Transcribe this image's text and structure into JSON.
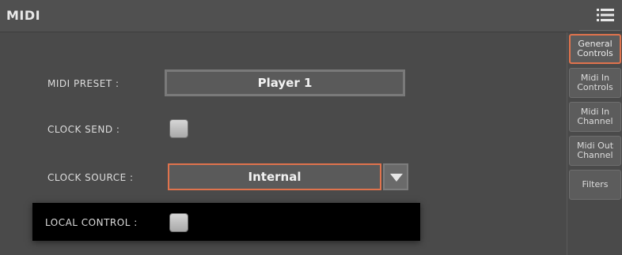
{
  "window": {
    "title": "MIDI"
  },
  "header": {
    "menu_icon": "hamburger-menu-icon"
  },
  "form": {
    "midi_preset": {
      "label": "MIDI PRESET :",
      "value": "Player 1"
    },
    "clock_send": {
      "label": "CLOCK SEND :",
      "checked": false
    },
    "clock_source": {
      "label": "CLOCK SOURCE :",
      "value": "Internal",
      "arrow_icon": "triangle-down-icon"
    },
    "local_control": {
      "label": "LOCAL CONTROL :",
      "checked": false
    }
  },
  "sidebar": {
    "tabs": [
      {
        "label": "General\nControls",
        "active": true
      },
      {
        "label": "Midi In\nControls",
        "active": false
      },
      {
        "label": "Midi In\nChannel",
        "active": false
      },
      {
        "label": "Midi Out\nChannel",
        "active": false
      },
      {
        "label": "Filters",
        "active": false
      }
    ]
  },
  "colors": {
    "accent": "#e0734d",
    "background": "#4a4a4a",
    "panel_black": "#000000"
  }
}
